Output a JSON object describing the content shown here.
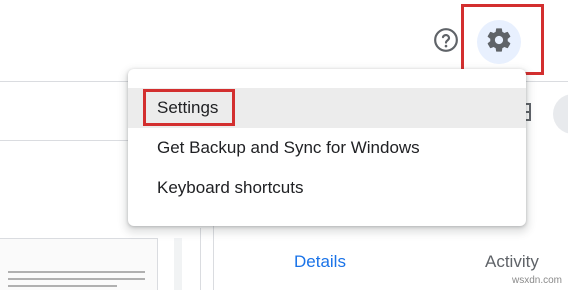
{
  "toolbar": {
    "help_icon": "help-circle-icon",
    "settings_icon": "gear-icon"
  },
  "menu": {
    "items": [
      {
        "label": "Settings",
        "active": true
      },
      {
        "label": "Get Backup and Sync for Windows",
        "active": false
      },
      {
        "label": "Keyboard shortcuts",
        "active": false
      }
    ]
  },
  "details_panel": {
    "tabs": [
      {
        "label": "Details",
        "selected": true
      },
      {
        "label": "Activity",
        "selected": false
      }
    ]
  },
  "watermark": "wsxdn.com",
  "colors": {
    "accent": "#1a73e8",
    "highlight_box": "#d32f2f",
    "gear_bg": "#e8f0fe",
    "menu_hover": "#ececec"
  }
}
